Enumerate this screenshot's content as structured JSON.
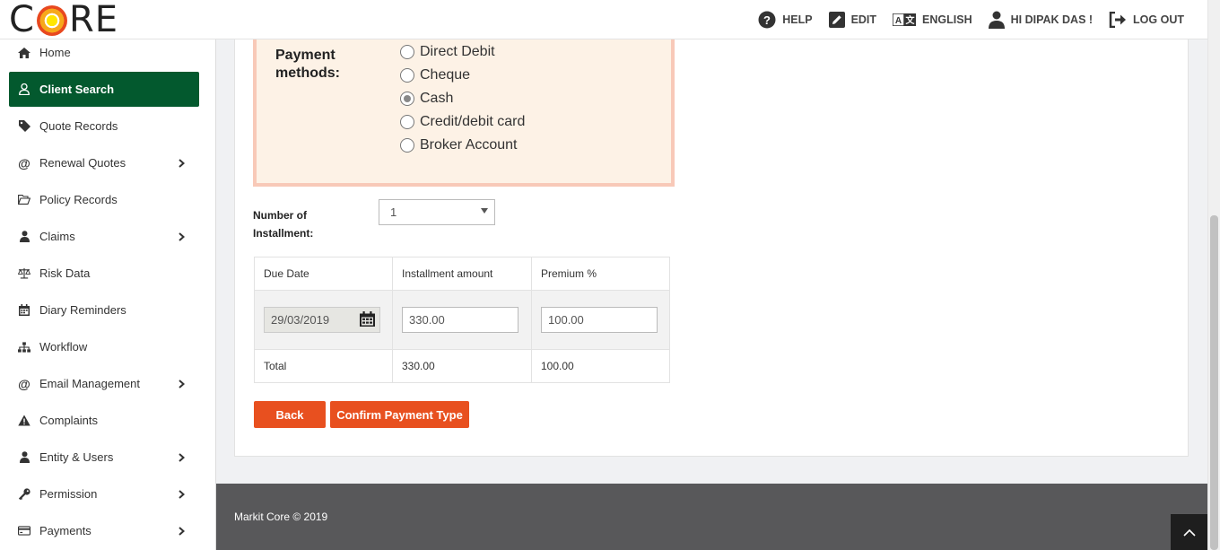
{
  "header": {
    "logo_left": "C",
    "logo_right": "RE",
    "nav": [
      {
        "label": "HELP",
        "icon": "help-icon"
      },
      {
        "label": "EDIT",
        "icon": "edit-icon"
      },
      {
        "label": "ENGLISH",
        "icon": "translate-icon"
      },
      {
        "label": "HI DIPAK DAS !",
        "icon": "user-icon"
      },
      {
        "label": "LOG OUT",
        "icon": "logout-icon"
      }
    ]
  },
  "sidebar": {
    "items": [
      {
        "label": "Home",
        "icon": "home-icon"
      },
      {
        "label": "Client Search",
        "icon": "user-outline-icon",
        "active": true
      },
      {
        "label": "Quote Records",
        "icon": "tag-icon"
      },
      {
        "label": "Renewal Quotes",
        "icon": "at-icon",
        "has_submenu": true
      },
      {
        "label": "Policy Records",
        "icon": "folder-open-icon"
      },
      {
        "label": "Claims",
        "icon": "user-icon",
        "has_submenu": true
      },
      {
        "label": "Risk Data",
        "icon": "balance-scale-icon"
      },
      {
        "label": "Diary Reminders",
        "icon": "calendar-icon"
      },
      {
        "label": "Workflow",
        "icon": "sitemap-icon"
      },
      {
        "label": "Email Management",
        "icon": "at-icon",
        "has_submenu": true
      },
      {
        "label": "Complaints",
        "icon": "warning-icon"
      },
      {
        "label": "Entity & Users",
        "icon": "user-icon",
        "has_submenu": true
      },
      {
        "label": "Permission",
        "icon": "key-icon",
        "has_submenu": true
      },
      {
        "label": "Payments",
        "icon": "credit-card-icon",
        "has_submenu": true
      }
    ]
  },
  "payment": {
    "label": "Payment methods:",
    "options": [
      "Direct Debit",
      "Cheque",
      "Cash",
      "Credit/debit card",
      "Broker Account"
    ],
    "selected": "Cash"
  },
  "installments": {
    "label": "Number of Installment:",
    "selected": "1",
    "columns": [
      "Due Date",
      "Installment amount",
      "Premium %"
    ],
    "row": {
      "due_date": "29/03/2019",
      "amount": "330.00",
      "premium": "100.00"
    },
    "total": {
      "label": "Total",
      "amount": "330.00",
      "premium": "100.00"
    }
  },
  "buttons": {
    "back": "Back",
    "confirm": "Confirm Payment Type"
  },
  "footer": {
    "text": "Markit Core © 2019"
  },
  "colors": {
    "active_menu": "#03592e",
    "button": "#e8501f",
    "box_bg": "#fdf2e6",
    "box_border": "#f8c9b8",
    "footer": "#58585a"
  }
}
